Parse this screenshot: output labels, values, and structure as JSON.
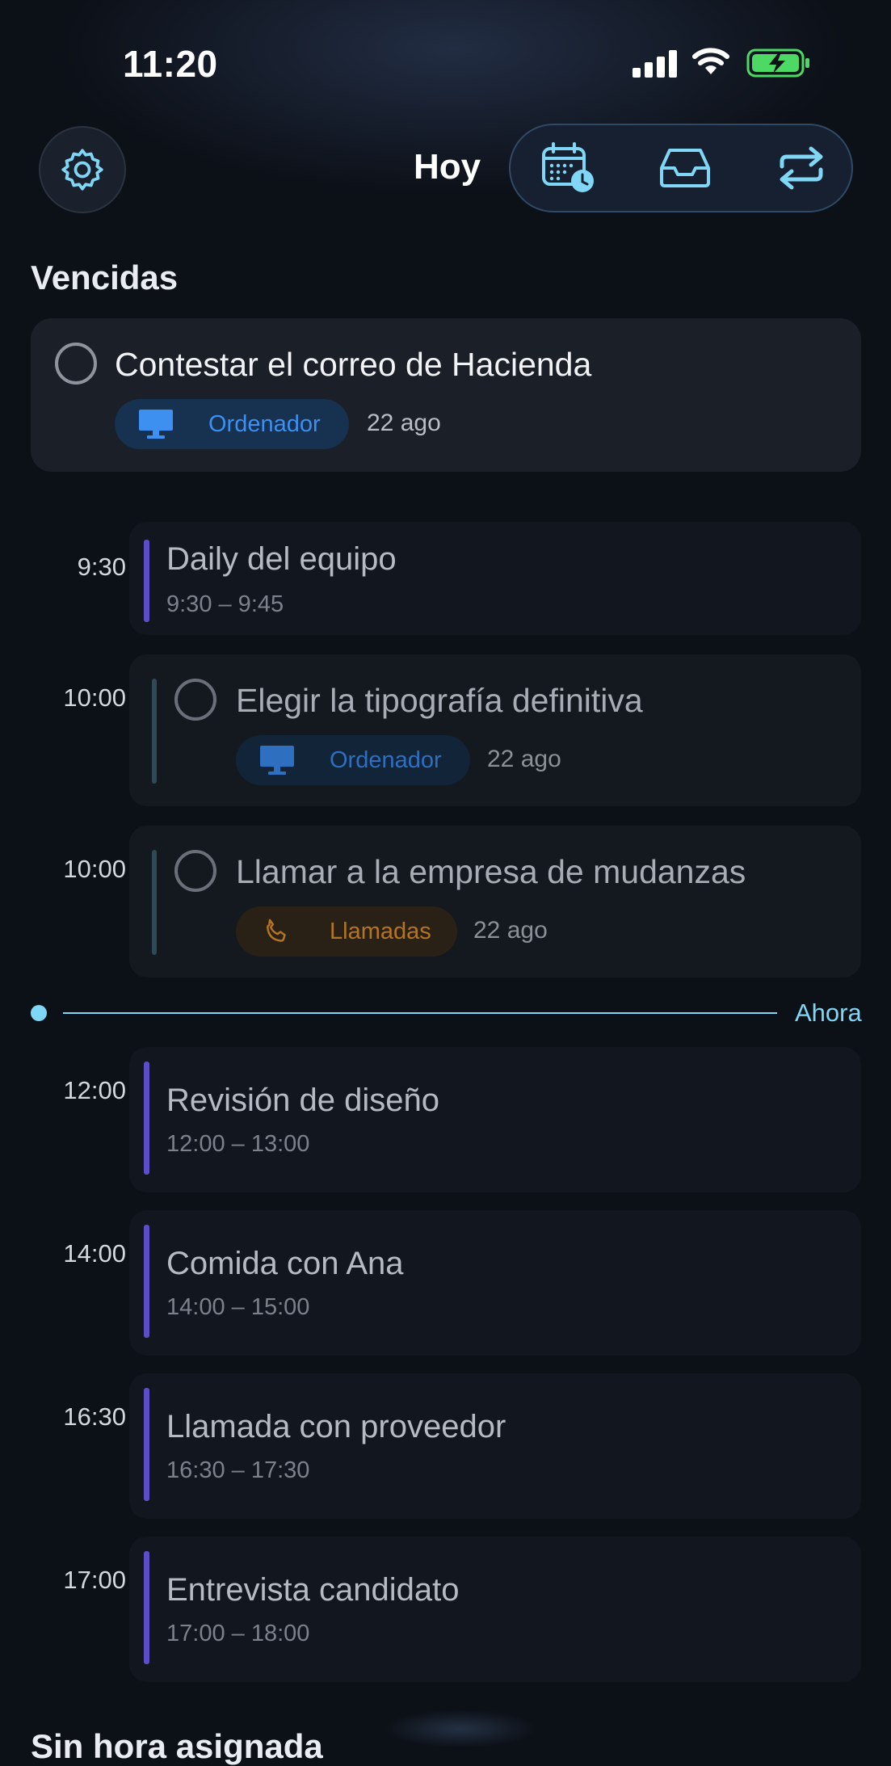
{
  "status_bar": {
    "time": "11:20"
  },
  "header": {
    "title": "Hoy",
    "settings_icon": "gear-icon",
    "segments": [
      "calendar-clock-icon",
      "inbox-tray-icon",
      "repeat-icon"
    ]
  },
  "colors": {
    "accent": "#7fd6f5",
    "event_bar": "#5b4fc9",
    "computer_tag": "#3d8ff0",
    "calls_tag": "#d08a2c",
    "battery": "#4cd964"
  },
  "overdue": {
    "heading": "Vencidas",
    "task": {
      "title": "Contestar el correo de Hacienda",
      "tag": "Ordenador",
      "tag_icon": "monitor-icon",
      "date": "22 ago"
    }
  },
  "timeline": {
    "e1": {
      "time": "9:30",
      "title": "Daily del equipo",
      "range": "9:30 – 9:45"
    },
    "t1": {
      "time": "10:00",
      "title": "Elegir la tipografía definitiva",
      "tag": "Ordenador",
      "tag_icon": "monitor-icon",
      "date": "22 ago"
    },
    "t2": {
      "time": "10:00",
      "title": "Llamar a la empresa de mudanzas",
      "tag": "Llamadas",
      "tag_icon": "phone-icon",
      "date": "22 ago"
    },
    "now_label": "Ahora",
    "e2": {
      "time": "12:00",
      "title": "Revisión de diseño",
      "range": "12:00 – 13:00"
    },
    "e3": {
      "time": "14:00",
      "title": "Comida con Ana",
      "range": "14:00 – 15:00"
    },
    "e4": {
      "time": "16:30",
      "title": "Llamada con proveedor",
      "range": "16:30 – 17:30"
    },
    "e5": {
      "time": "17:00",
      "title": "Entrevista candidato",
      "range": "17:00 – 18:00"
    }
  },
  "next_section": {
    "heading": "Sin hora asignada"
  }
}
